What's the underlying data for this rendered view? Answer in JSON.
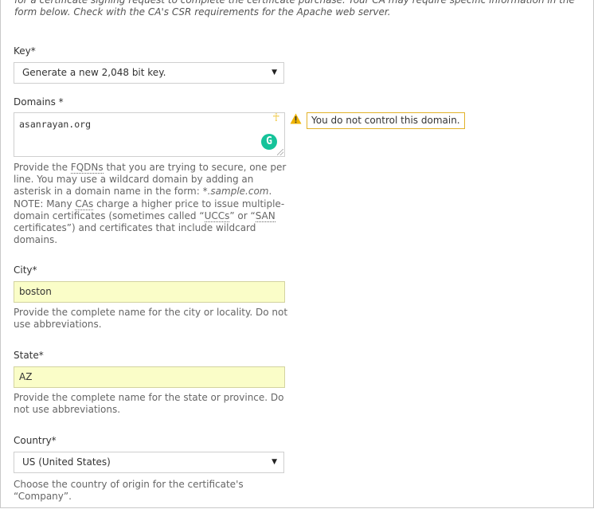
{
  "intro": {
    "line1": "for a certificate signing request to complete the certificate purchase. Your CA may require specific information in the",
    "line2": "form below. Check with the CA's CSR requirements for the Apache web server."
  },
  "key": {
    "label": "Key*",
    "value": "Generate a new 2,048 bit key."
  },
  "domains": {
    "label": "Domains *",
    "value": "asanrayan.org",
    "warning": "You do not control this domain.",
    "help": {
      "p1": "Provide the ",
      "fqdn": "FQDNs",
      "p2": " that you are trying to secure, one per line. You may use a wildcard domain by adding an asterisk in a domain name in the form: ",
      "example": "*.sample.com",
      "p3": ". NOTE: Many ",
      "cas": "CAs",
      "p4": " charge a higher price to issue multiple-domain certificates (sometimes called “",
      "ucc": "UCCs",
      "p5": "” or “",
      "san": "SAN",
      "p6": " certificates”) and certificates that include wildcard domains."
    }
  },
  "city": {
    "label": "City*",
    "value": "boston",
    "help": "Provide the complete name for the city or locality. Do not use abbreviations."
  },
  "state": {
    "label": "State*",
    "value": "AZ",
    "help": "Provide the complete name for the state or province. Do not use abbreviations."
  },
  "country": {
    "label": "Country*",
    "value": "US (United States)",
    "help": "Choose the country of origin for the certificate's “Company”."
  },
  "icons": {
    "dropdown": "caret-down-icon",
    "warning": "warning-triangle-icon",
    "grammarly": "grammarly-icon",
    "ankh": "ankh-icon",
    "resize": "resize-handle-icon"
  },
  "colors": {
    "autofill_bg": "#fafdc8",
    "warning_border": "#e2b22a",
    "grammarly": "#15c39a"
  }
}
